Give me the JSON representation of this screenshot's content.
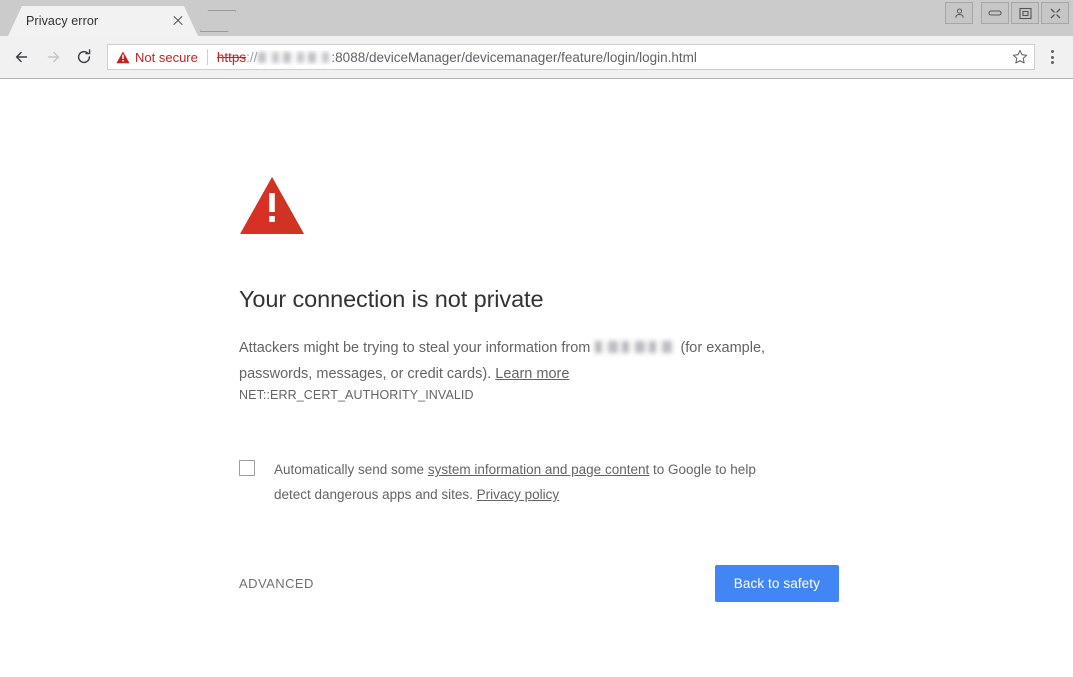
{
  "window": {
    "controls": [
      {
        "name": "profile-avatar",
        "icon": "person-icon",
        "label": "Profile"
      },
      {
        "name": "minimize",
        "icon": "minimize-icon",
        "label": "Minimize"
      },
      {
        "name": "maximize",
        "icon": "restore-icon",
        "label": "Restore"
      },
      {
        "name": "close",
        "icon": "close-icon",
        "label": "Close"
      }
    ]
  },
  "tabstrip": {
    "tabs": [
      {
        "title": "Privacy error",
        "close_label": "Close tab"
      }
    ],
    "new_tab_label": "New tab"
  },
  "toolbar": {
    "back_label": "Back",
    "forward_label": "Forward",
    "reload_label": "Reload",
    "security": {
      "icon": "warning-triangle-icon",
      "label": "Not secure",
      "color": "#c5221f"
    },
    "url": {
      "scheme": "https",
      "separator": "://",
      "host": "",
      "host_redacted": true,
      "rest": ":8088/deviceManager/devicemanager/feature/login/login.html"
    },
    "bookmark_label": "Bookmark this page",
    "menu_label": "Customize and control Google Chrome"
  },
  "interstitial": {
    "icon": "warning-triangle-icon",
    "icon_color": "#d93025",
    "heading": "Your connection is not private",
    "body_part1": "Attackers might be trying to steal your information from",
    "body_host_redacted": true,
    "body_part2": "(for example, passwords, messages, or credit cards).",
    "learn_more": "Learn more",
    "error_code": "NET::ERR_CERT_AUTHORITY_INVALID",
    "optin": {
      "checked": false,
      "text_part1": "Automatically send some",
      "link1": "system information and page content",
      "text_part2": "to Google to help detect dangerous apps and sites.",
      "link2": "Privacy policy"
    },
    "advanced_label": "ADVANCED",
    "primary_label": "Back to safety",
    "primary_color": "#4285f4"
  }
}
